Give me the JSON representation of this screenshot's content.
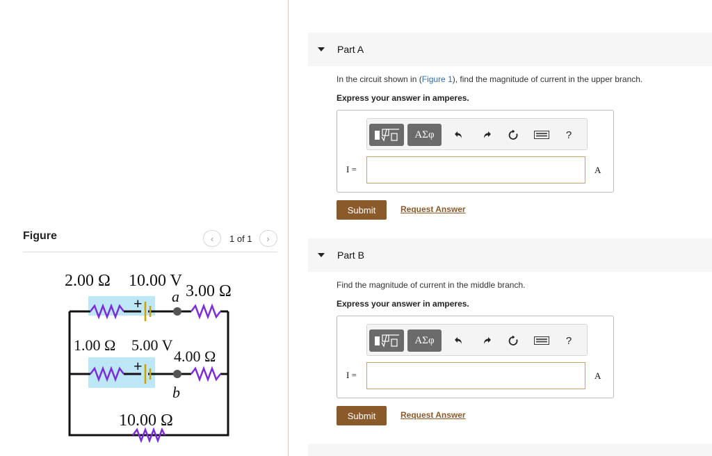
{
  "figure": {
    "label": "Figure",
    "pager_text": "1 of 1",
    "prev_icon": "chevron-left-icon",
    "next_icon": "chevron-right-icon",
    "circuit": {
      "r_top_left": "2.00 Ω",
      "emf_top": "10.00 V",
      "node_a": "a",
      "r_top_right": "3.00 Ω",
      "r_mid_left": "1.00 Ω",
      "emf_mid": "5.00 V",
      "r_mid_right": "4.00 Ω",
      "node_b": "b",
      "r_bottom": "10.00 Ω",
      "plus": "+",
      "resistor_color": "#7b2ed6",
      "battery_color": "#c9a400",
      "highlight_color": "#bde6f7"
    }
  },
  "parts": [
    {
      "title": "Part A",
      "question_prefix": "In the circuit shown in (",
      "question_link": "Figure 1",
      "question_suffix": "), find the magnitude of current in the upper branch.",
      "instruction": "Express your answer in amperes.",
      "answer_label": "I =",
      "answer_value": "",
      "unit": "A",
      "submit": "Submit",
      "request": "Request Answer"
    },
    {
      "title": "Part B",
      "question": "Find the magnitude of current in the middle branch.",
      "instruction": "Express your answer in amperes.",
      "answer_label": "I =",
      "answer_value": "",
      "unit": "A",
      "submit": "Submit",
      "request": "Request Answer"
    }
  ],
  "toolbar": {
    "greek": "ΑΣφ",
    "help": "?",
    "icons": [
      "templates-icon",
      "greek-letters-icon",
      "undo-icon",
      "redo-icon",
      "reset-icon",
      "keyboard-icon",
      "help-icon"
    ]
  },
  "colors": {
    "accent": "#8a5a2b",
    "link": "#2a6fb0",
    "input_border": "#c8a36a"
  }
}
